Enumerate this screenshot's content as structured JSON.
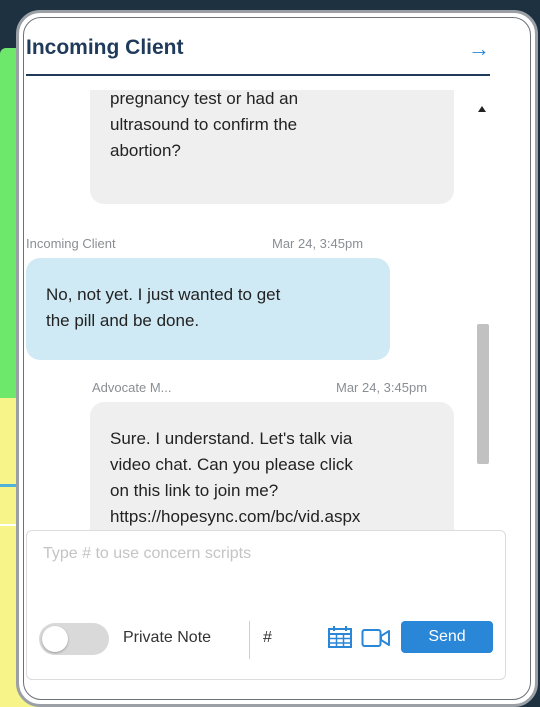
{
  "header": {
    "title": "Incoming Client",
    "collapse_icon": "arrow-right-icon"
  },
  "messages": [
    {
      "sender": "",
      "time": "",
      "type": "advocate",
      "lines": [
        "pregnancy test or had an",
        "ultrasound to confirm the",
        "abortion?"
      ]
    },
    {
      "sender": "Incoming Client",
      "time": "Mar 24, 3:45pm",
      "type": "client",
      "lines": [
        "No, not yet. I just wanted to get",
        "the pill and be done."
      ]
    },
    {
      "sender": "Advocate M...",
      "time": "Mar 24, 3:45pm",
      "type": "advocate",
      "lines": [
        "Sure. I understand. Let's talk via",
        "video chat. Can you please click",
        "on this link to join me?",
        "https://hopesync.com/bc/vid.aspx"
      ]
    }
  ],
  "composer": {
    "placeholder": "Type # to use concern scripts",
    "value": "",
    "private_note_label": "Private Note",
    "private_note_on": false,
    "hash_label": "#",
    "send_label": "Send"
  },
  "colors": {
    "accent": "#2a86d6",
    "title": "#1f3a5a",
    "client_bubble": "#cfeaf5",
    "advocate_bubble": "#efefef"
  }
}
